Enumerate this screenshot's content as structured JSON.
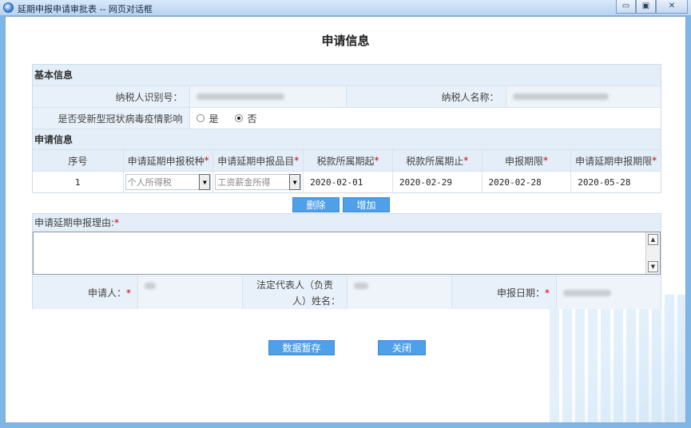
{
  "window": {
    "title": "延期申报申请审批表 -- 网页对话框",
    "minimize": "▭",
    "maximize": "▣",
    "close": "✕"
  },
  "page_title": "申请信息",
  "basic": {
    "section_label": "基本信息",
    "taxpayer_id_label": "纳税人识别号：",
    "taxpayer_name_label": "纳税人名称：",
    "covid_label": "是否受新型冠状病毒疫情影响",
    "yes_label": "是",
    "no_label": "否",
    "selected": "否"
  },
  "application": {
    "section_label": "申请信息",
    "headers": [
      "序号",
      "申请延期申报税种",
      "申请延期申报品目",
      "税款所属期起",
      "税款所属期止",
      "申报期限",
      "申请延期申报期限"
    ],
    "row": {
      "index": "1",
      "tax_type": "个人所得税",
      "tax_item": "工资薪金所得",
      "period_start": "2020-02-01",
      "period_end": "2020-02-29",
      "deadline": "2020-02-28",
      "extended_deadline": "2020-05-28"
    },
    "delete_label": "删除",
    "add_label": "增加"
  },
  "reason": {
    "label": "申请延期申报理由:",
    "value": ""
  },
  "signers": {
    "applicant_label": "申请人：",
    "legal_rep_label_1": "法定代表人（负责",
    "legal_rep_label_2": "人）姓名：",
    "date_label": "申报日期："
  },
  "buttons": {
    "save_label": "数据暂存",
    "close_label": "关闭"
  },
  "colors": {
    "accent": "#4ea0e8",
    "header_bg": "#e3eef8",
    "required": "#d20000"
  }
}
